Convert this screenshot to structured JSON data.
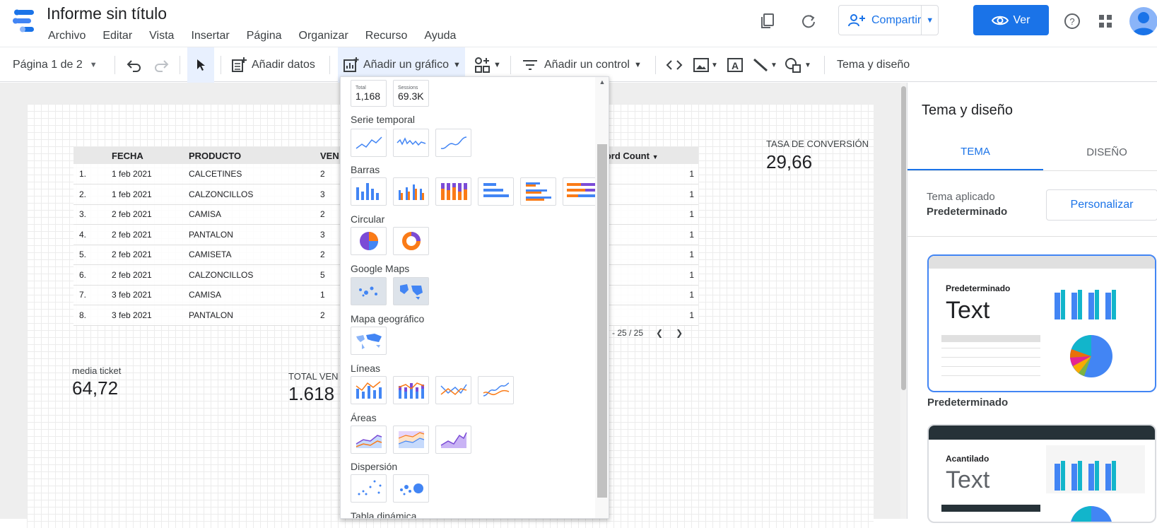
{
  "app": {
    "title": "Informe sin título",
    "menu": [
      "Archivo",
      "Editar",
      "Vista",
      "Insertar",
      "Página",
      "Organizar",
      "Recurso",
      "Ayuda"
    ],
    "share_label": "Compartir",
    "view_label": "Ver"
  },
  "toolbar": {
    "page_indicator": "Página 1 de 2",
    "add_data": "Añadir datos",
    "add_chart": "Añadir un gráfico",
    "add_control": "Añadir un control",
    "theme_layout": "Tema y diseño"
  },
  "table": {
    "headers": [
      "FECHA",
      "PRODUCTO",
      "VEN",
      "Record Count"
    ],
    "rows": [
      [
        "1.",
        "1 feb 2021",
        "CALCETINES",
        "2",
        "1"
      ],
      [
        "2.",
        "1 feb 2021",
        "CALZONCILLOS",
        "3",
        "1"
      ],
      [
        "3.",
        "2 feb 2021",
        "CAMISA",
        "2",
        "1"
      ],
      [
        "4.",
        "2 feb 2021",
        "PANTALON",
        "3",
        "1"
      ],
      [
        "5.",
        "2 feb 2021",
        "CAMISETA",
        "2",
        "1"
      ],
      [
        "6.",
        "2 feb 2021",
        "CALZONCILLOS",
        "5",
        "1"
      ],
      [
        "7.",
        "3 feb 2021",
        "CAMISA",
        "1",
        "1"
      ],
      [
        "8.",
        "3 feb 2021",
        "PANTALON",
        "2",
        "1"
      ]
    ],
    "sort_icon": "caret-down-icon",
    "pager": "- 25 / 25"
  },
  "scorecards": {
    "conversion_label": "TASA DE CONVERSIÓN",
    "conversion_value": "29,66",
    "ticket_label": "media ticket",
    "ticket_value": "64,72",
    "total_label": "TOTAL VEN",
    "total_value": "1.618"
  },
  "chart_menu": {
    "scorecard_thumbs": [
      {
        "label": "Total",
        "value": "1,168"
      },
      {
        "label": "Sessions",
        "value": "69.3K"
      }
    ],
    "sections": {
      "timeseries": "Serie temporal",
      "bars": "Barras",
      "pie": "Circular",
      "google_maps": "Google Maps",
      "geo_map": "Mapa geográfico",
      "lines": "Líneas",
      "areas": "Áreas",
      "scatter": "Dispersión",
      "pivot": "Tabla dinámica"
    }
  },
  "panel": {
    "title": "Tema y diseño",
    "tab_theme": "TEMA",
    "tab_layout": "DISEÑO",
    "applied_label": "Tema aplicado",
    "applied_value": "Predeterminado",
    "customize": "Personalizar",
    "theme1_card_title": "Predeterminado",
    "theme1_text": "Text",
    "theme1_name": "Predeterminado",
    "theme2_card_title": "Acantilado",
    "theme2_text": "Text"
  },
  "colors": {
    "accent": "#1a73e8",
    "bar_blue": "#4285f4",
    "bar_teal": "#12b5cb",
    "pie_purple": "#7b4bd6",
    "pie_orange": "#fa7b17"
  }
}
